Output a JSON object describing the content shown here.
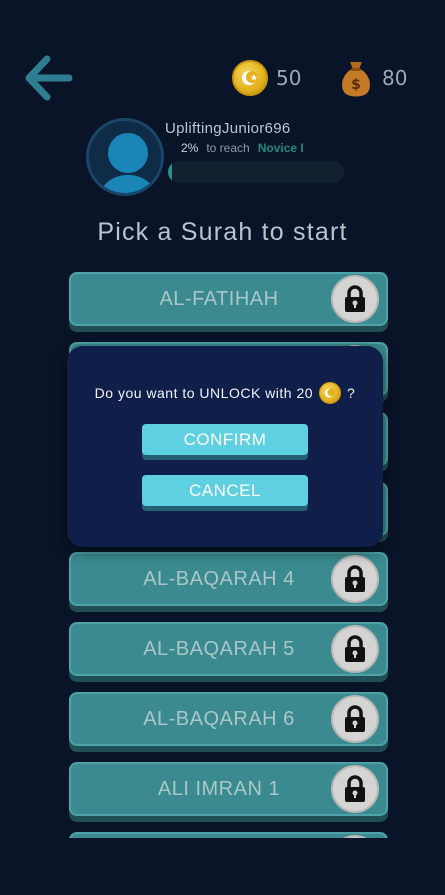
{
  "header": {
    "coins": "50",
    "bags": "80"
  },
  "profile": {
    "username": "UpliftingJunior696",
    "progress_percent_label": "2%",
    "progress_value": 0.02,
    "to_reach": "to reach",
    "next_rank": "Novice I"
  },
  "page_title": "Pick a Surah to start",
  "surahs": [
    {
      "label": "AL-FATIHAH"
    },
    {
      "label": ""
    },
    {
      "label": ""
    },
    {
      "label": ""
    },
    {
      "label": "AL-BAQARAH 4"
    },
    {
      "label": "AL-BAQARAH 5"
    },
    {
      "label": "AL-BAQARAH 6"
    },
    {
      "label": "ALI IMRAN 1"
    },
    {
      "label": ""
    }
  ],
  "dialog": {
    "message_prefix": "Do you want to UNLOCK with 20",
    "message_suffix": "?",
    "confirm_label": "CONFIRM",
    "cancel_label": "CANCEL"
  },
  "colors": {
    "background": "#0a1428",
    "item_face": "#3b8a8f",
    "button_face": "#5fd0e2",
    "dialog_bg": "#0f1f4a"
  }
}
